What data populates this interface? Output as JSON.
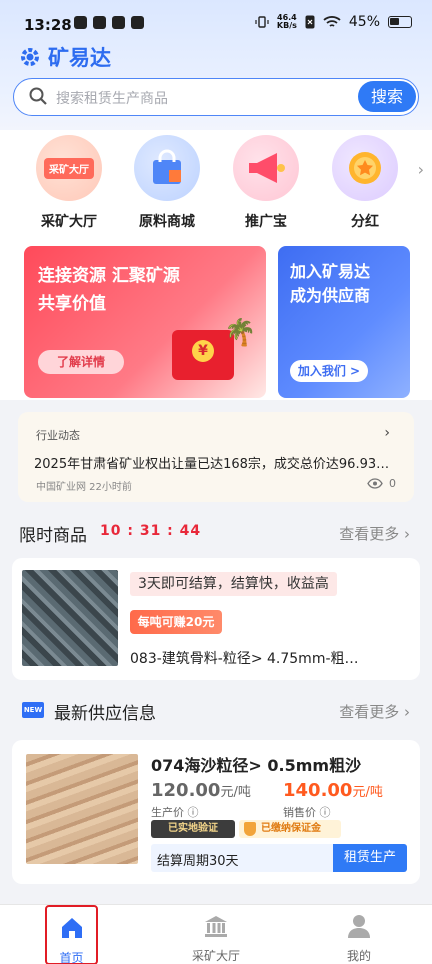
{
  "status_bar": {
    "time": "13:28",
    "net_speed_top": "46.4",
    "net_speed_bottom": "KB/s",
    "battery": "45%"
  },
  "header": {
    "app_name": "矿易达",
    "search_placeholder": "搜索租赁生产商品",
    "search_button": "搜索"
  },
  "categories": [
    {
      "label": "采矿大厅",
      "icon": "mining-hall-icon",
      "badge": "采矿大厅",
      "color": "#ff6a5a"
    },
    {
      "label": "原料商城",
      "icon": "shopping-bag-icon",
      "color": "#4f86f7"
    },
    {
      "label": "推广宝",
      "icon": "megaphone-icon",
      "color": "#ff5577"
    },
    {
      "label": "分红",
      "icon": "gold-coin-icon",
      "color": "#ffb52e"
    }
  ],
  "banners": {
    "left": {
      "line1": "连接资源 汇聚矿源",
      "line2": "共享价值",
      "button": "了解详情"
    },
    "right": {
      "line1": "加入矿易达",
      "line2": "成为供应商",
      "button": "加入我们 >"
    }
  },
  "news": {
    "tag": "行业动态",
    "text": "2025年甘肃省矿业权出让量已达168宗，成交总价达96.93…",
    "source": "中国矿业网 22小时前",
    "views": "0"
  },
  "flash_sale": {
    "title": "限时商品",
    "timer": "10 : 31 : 44",
    "more": "查看更多",
    "product": {
      "tagline": "3天即可结算，结算快，收益高",
      "earn": "每吨可赚20元",
      "name": "083-建筑骨料-粒径> 4.75mm-粗…"
    }
  },
  "supply": {
    "new_badge": "NEW",
    "title": "最新供应信息",
    "more": "查看更多",
    "item": {
      "name": "074海沙粒径> 0.5mm粗沙",
      "cost_price": "120.00",
      "cost_unit": "元/吨",
      "cost_label": "生产价",
      "sale_price": "140.00",
      "sale_unit": "元/吨",
      "sale_label": "销售价",
      "verified": "已实地验证",
      "deposit": "已缴纳保证金",
      "cycle": "结算周期30天",
      "button": "租赁生产"
    }
  },
  "tabbar": [
    {
      "label": "首页",
      "icon": "home-icon",
      "active": true
    },
    {
      "label": "采矿大厅",
      "icon": "bank-building-icon",
      "active": false
    },
    {
      "label": "我的",
      "icon": "user-icon",
      "active": false
    }
  ]
}
